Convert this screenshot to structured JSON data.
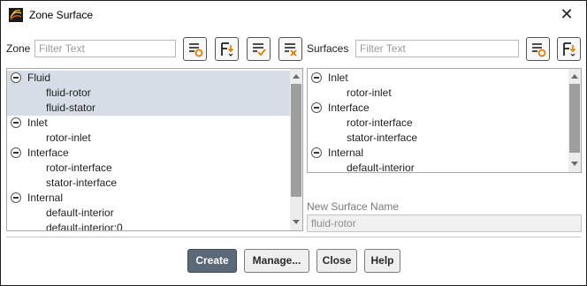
{
  "window": {
    "title": "Zone Surface",
    "icon": "fluent-app-icon",
    "close_icon": "close-icon"
  },
  "zone": {
    "label": "Zone",
    "filter_placeholder": "Filter Text",
    "toolbar_icons": [
      "select-all-icon",
      "select-by-type-icon",
      "check-list-icon",
      "deselect-all-icon"
    ],
    "tree": [
      {
        "type": "group",
        "label": "Fluid",
        "selected": true
      },
      {
        "type": "item",
        "label": "fluid-rotor",
        "selected": true
      },
      {
        "type": "item",
        "label": "fluid-stator",
        "selected": true
      },
      {
        "type": "group",
        "label": "Inlet",
        "selected": false
      },
      {
        "type": "item",
        "label": "rotor-inlet",
        "selected": false
      },
      {
        "type": "group",
        "label": "Interface",
        "selected": false
      },
      {
        "type": "item",
        "label": "rotor-interface",
        "selected": false
      },
      {
        "type": "item",
        "label": "stator-interface",
        "selected": false
      },
      {
        "type": "group",
        "label": "Internal",
        "selected": false
      },
      {
        "type": "item",
        "label": "default-interior",
        "selected": false
      },
      {
        "type": "item",
        "label": "default-interior:0",
        "selected": false
      }
    ]
  },
  "surfaces": {
    "label": "Surfaces",
    "filter_placeholder": "Filter Text",
    "toolbar_icons": [
      "select-all-icon",
      "select-by-type-icon"
    ],
    "tree": [
      {
        "type": "group",
        "label": "Inlet"
      },
      {
        "type": "item",
        "label": "rotor-inlet"
      },
      {
        "type": "group",
        "label": "Interface"
      },
      {
        "type": "item",
        "label": "rotor-interface"
      },
      {
        "type": "item",
        "label": "stator-interface"
      },
      {
        "type": "group",
        "label": "Internal"
      },
      {
        "type": "item",
        "label": "default-interior"
      }
    ]
  },
  "new_surface": {
    "label": "New Surface Name",
    "value": "fluid-rotor"
  },
  "buttons": {
    "create": "Create",
    "manage": "Manage...",
    "close": "Close",
    "help": "Help"
  },
  "colors": {
    "primary_button": "#5a6877",
    "selection": "#d6dde6",
    "accent_orange": "#e07b00"
  }
}
